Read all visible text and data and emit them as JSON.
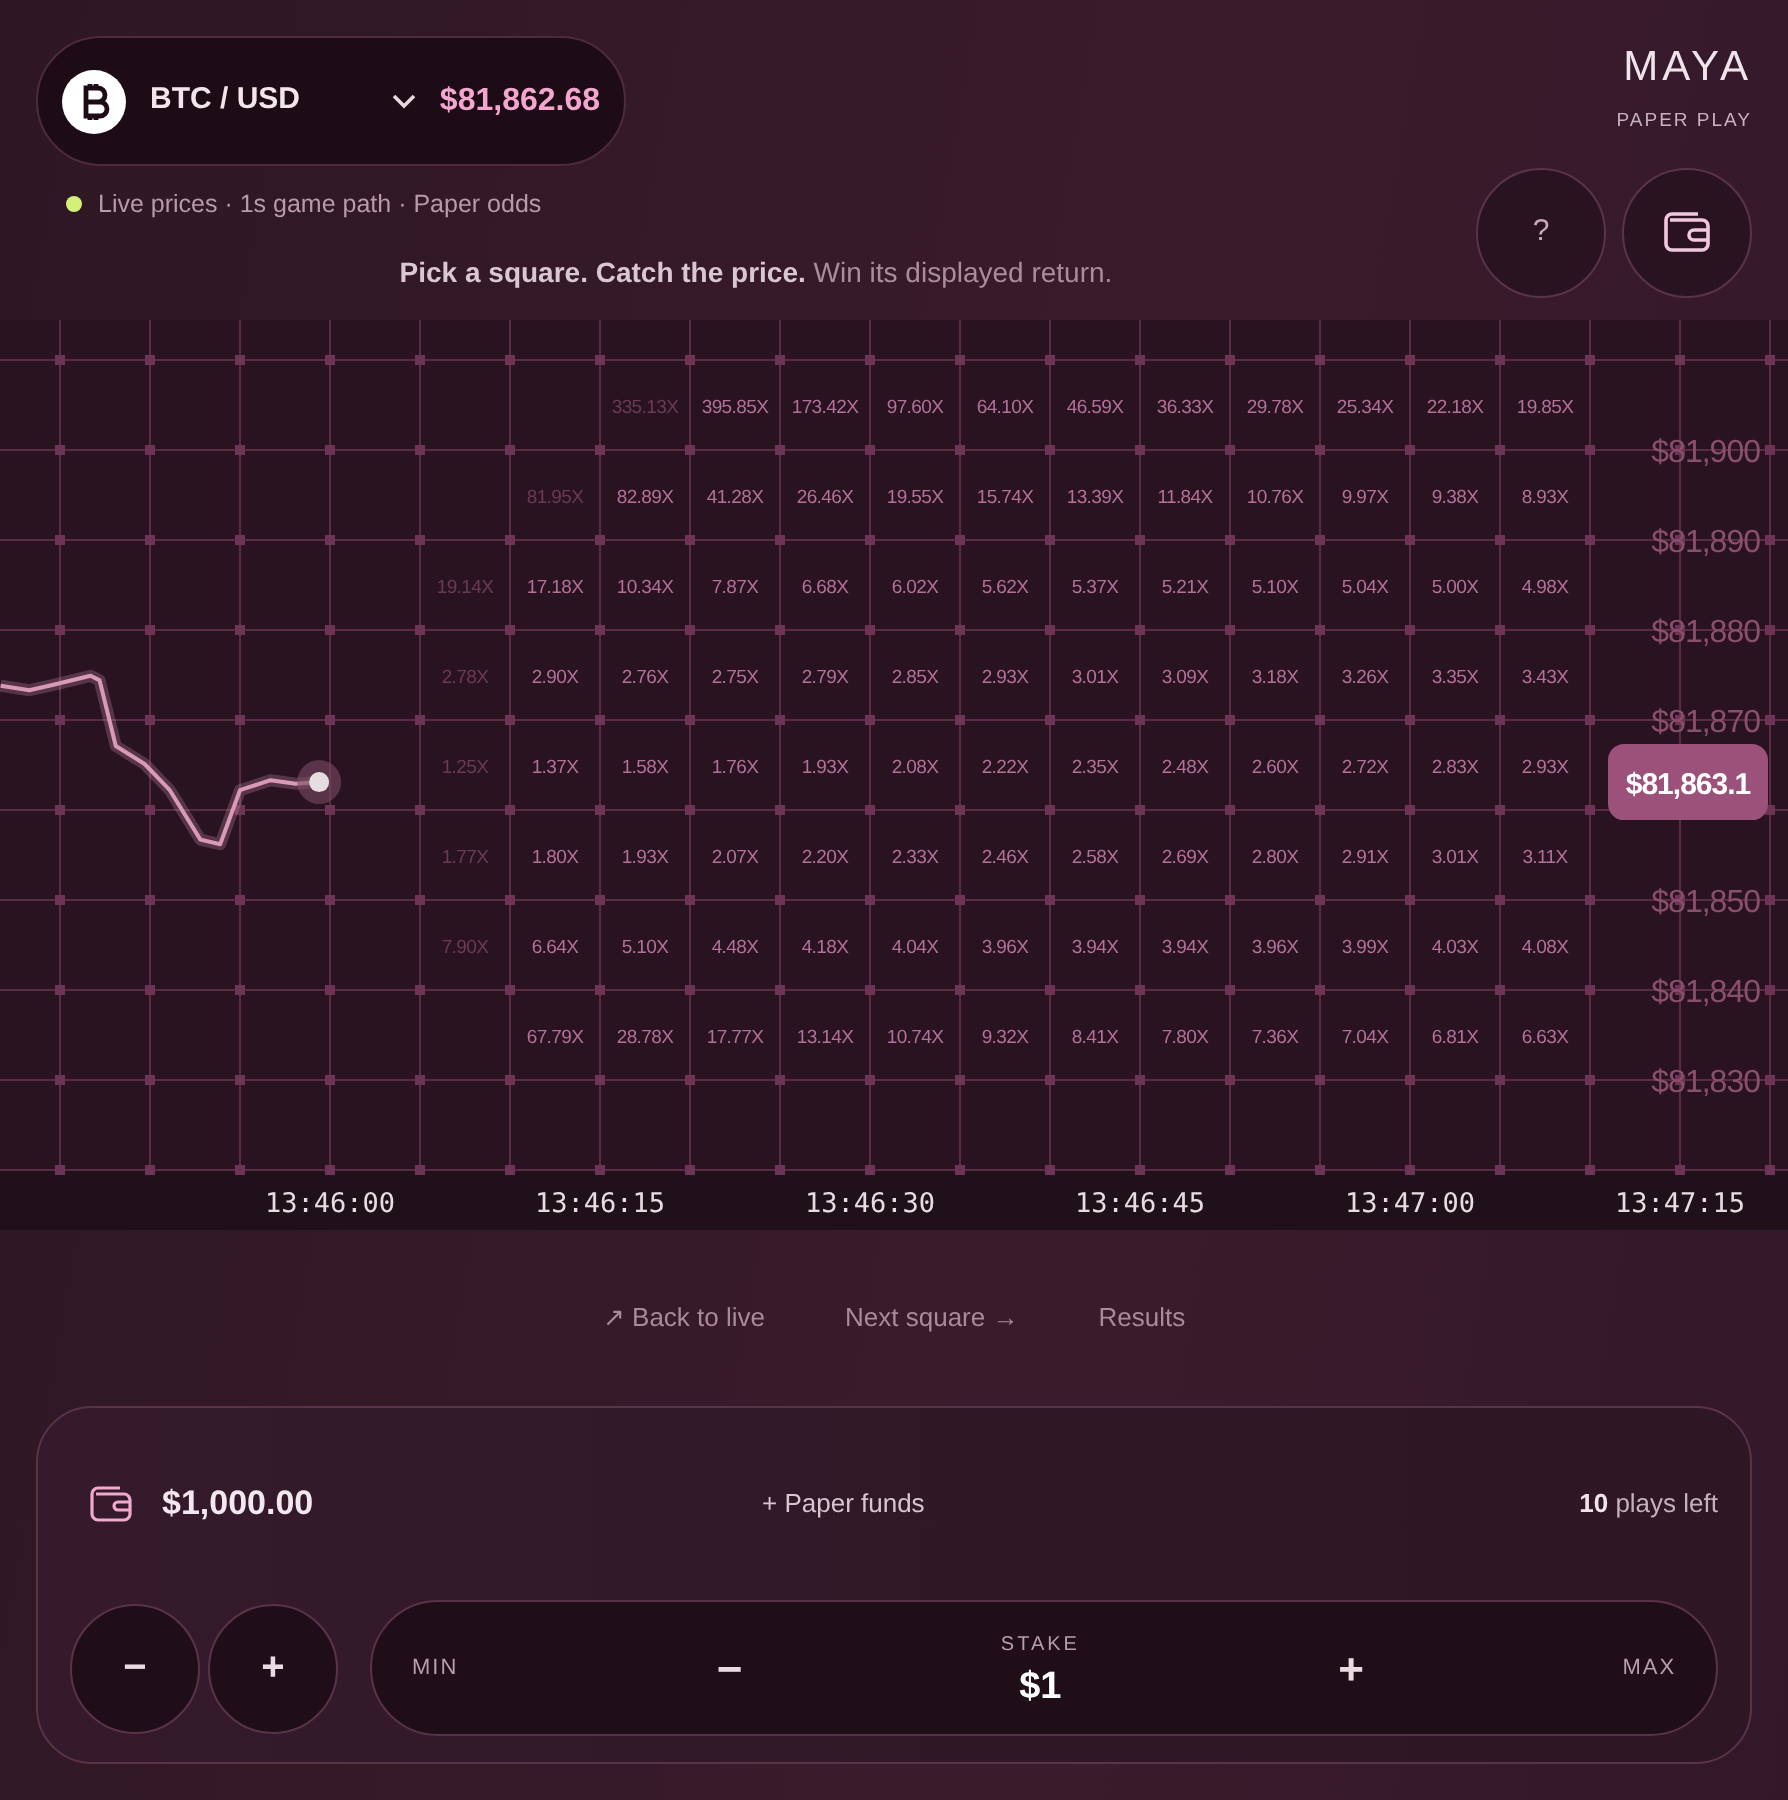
{
  "pair": {
    "label": "BTC / USD",
    "price": "$81,862.68"
  },
  "status": {
    "text": "Live prices · 1s game path · Paper odds",
    "live": true
  },
  "tagline": "**Pick a square. Catch the price.** Win its displayed return.",
  "brand": {
    "name": "MAYA",
    "subtitle": "PAPER PLAY"
  },
  "header_buttons": [
    {
      "kind": "help",
      "label": "?"
    },
    {
      "kind": "wallet"
    }
  ],
  "chart": {
    "chart_data": {
      "type": "line",
      "grid": true,
      "series": [
        {
          "color": "#d99ab8",
          "values": [
            81873.8,
            81873.3,
            81873.8,
            81874.9,
            81874.4,
            81867.1,
            81865.1,
            81862.2,
            81856.7,
            81856.2,
            81862.2,
            81863.3,
            81862.9,
            81863.1
          ]
        }
      ],
      "x": [
        49541.7,
        49543.3,
        49544.4,
        49546.7,
        49547.2,
        49548.1,
        49549.7,
        49551.1,
        49552.8,
        49553.9,
        49555,
        49556.7,
        49558.1,
        49559.4
      ],
      "xlim": [
        49541.67,
        49641
      ],
      "ylim": [
        81813.33,
        81914.44
      ],
      "xticks": [
        {
          "value": 49560,
          "label": "13:46:00"
        },
        {
          "value": 49575,
          "label": "13:46:15"
        },
        {
          "value": 49590,
          "label": "13:46:30"
        },
        {
          "value": 49605,
          "label": "13:46:45"
        },
        {
          "value": 49620,
          "label": "13:47:00"
        },
        {
          "value": 49635,
          "label": "13:47:15"
        }
      ],
      "yticks": [
        {
          "value": 81900,
          "label": "$81,900"
        },
        {
          "value": 81890,
          "label": "$81,890"
        },
        {
          "value": 81880,
          "label": "$81,880"
        },
        {
          "value": 81870,
          "label": "$81,870"
        },
        {
          "value": 81850,
          "label": "$81,850"
        },
        {
          "value": 81840,
          "label": "$81,840"
        },
        {
          "value": 81830,
          "label": "$81,830"
        }
      ]
    },
    "current_price": "$81,863.1",
    "grid": [
      [
        {
          "text": "335.13X",
          "faded": true
        },
        {
          "text": "395.85X",
          "faded": false
        },
        {
          "text": "173.42X",
          "faded": false
        },
        {
          "text": "97.60X",
          "faded": false
        },
        {
          "text": "64.10X",
          "faded": false
        },
        {
          "text": "46.59X",
          "faded": false
        },
        {
          "text": "36.33X",
          "faded": false
        },
        {
          "text": "29.78X",
          "faded": false
        },
        {
          "text": "25.34X",
          "faded": false
        },
        {
          "text": "22.18X",
          "faded": false
        },
        {
          "text": "19.85X",
          "faded": false
        }
      ],
      [
        {
          "text": "81.95X",
          "faded": true
        },
        {
          "text": "82.89X",
          "faded": false
        },
        {
          "text": "41.28X",
          "faded": false
        },
        {
          "text": "26.46X",
          "faded": false
        },
        {
          "text": "19.55X",
          "faded": false
        },
        {
          "text": "15.74X",
          "faded": false
        },
        {
          "text": "13.39X",
          "faded": false
        },
        {
          "text": "11.84X",
          "faded": false
        },
        {
          "text": "10.76X",
          "faded": false
        },
        {
          "text": "9.97X",
          "faded": false
        },
        {
          "text": "9.38X",
          "faded": false
        },
        {
          "text": "8.93X",
          "faded": false
        }
      ],
      [
        {
          "text": "19.14X",
          "faded": true
        },
        {
          "text": "17.18X",
          "faded": false
        },
        {
          "text": "10.34X",
          "faded": false
        },
        {
          "text": "7.87X",
          "faded": false
        },
        {
          "text": "6.68X",
          "faded": false
        },
        {
          "text": "6.02X",
          "faded": false
        },
        {
          "text": "5.62X",
          "faded": false
        },
        {
          "text": "5.37X",
          "faded": false
        },
        {
          "text": "5.21X",
          "faded": false
        },
        {
          "text": "5.10X",
          "faded": false
        },
        {
          "text": "5.04X",
          "faded": false
        },
        {
          "text": "5.00X",
          "faded": false
        },
        {
          "text": "4.98X",
          "faded": false
        }
      ],
      [
        {
          "text": "2.78X",
          "faded": true
        },
        {
          "text": "2.90X",
          "faded": false
        },
        {
          "text": "2.76X",
          "faded": false
        },
        {
          "text": "2.75X",
          "faded": false
        },
        {
          "text": "2.79X",
          "faded": false
        },
        {
          "text": "2.85X",
          "faded": false
        },
        {
          "text": "2.93X",
          "faded": false
        },
        {
          "text": "3.01X",
          "faded": false
        },
        {
          "text": "3.09X",
          "faded": false
        },
        {
          "text": "3.18X",
          "faded": false
        },
        {
          "text": "3.26X",
          "faded": false
        },
        {
          "text": "3.35X",
          "faded": false
        },
        {
          "text": "3.43X",
          "faded": false
        }
      ],
      [
        {
          "text": "1.25X",
          "faded": true
        },
        {
          "text": "1.37X",
          "faded": false
        },
        {
          "text": "1.58X",
          "faded": false
        },
        {
          "text": "1.76X",
          "faded": false
        },
        {
          "text": "1.93X",
          "faded": false
        },
        {
          "text": "2.08X",
          "faded": false
        },
        {
          "text": "2.22X",
          "faded": false
        },
        {
          "text": "2.35X",
          "faded": false
        },
        {
          "text": "2.48X",
          "faded": false
        },
        {
          "text": "2.60X",
          "faded": false
        },
        {
          "text": "2.72X",
          "faded": false
        },
        {
          "text": "2.83X",
          "faded": false
        },
        {
          "text": "2.93X",
          "faded": false
        }
      ],
      [
        {
          "text": "1.77X",
          "faded": true
        },
        {
          "text": "1.80X",
          "faded": false
        },
        {
          "text": "1.93X",
          "faded": false
        },
        {
          "text": "2.07X",
          "faded": false
        },
        {
          "text": "2.20X",
          "faded": false
        },
        {
          "text": "2.33X",
          "faded": false
        },
        {
          "text": "2.46X",
          "faded": false
        },
        {
          "text": "2.58X",
          "faded": false
        },
        {
          "text": "2.69X",
          "faded": false
        },
        {
          "text": "2.80X",
          "faded": false
        },
        {
          "text": "2.91X",
          "faded": false
        },
        {
          "text": "3.01X",
          "faded": false
        },
        {
          "text": "3.11X",
          "faded": false
        }
      ],
      [
        {
          "text": "7.90X",
          "faded": true
        },
        {
          "text": "6.64X",
          "faded": false
        },
        {
          "text": "5.10X",
          "faded": false
        },
        {
          "text": "4.48X",
          "faded": false
        },
        {
          "text": "4.18X",
          "faded": false
        },
        {
          "text": "4.04X",
          "faded": false
        },
        {
          "text": "3.96X",
          "faded": false
        },
        {
          "text": "3.94X",
          "faded": false
        },
        {
          "text": "3.94X",
          "faded": false
        },
        {
          "text": "3.96X",
          "faded": false
        },
        {
          "text": "3.99X",
          "faded": false
        },
        {
          "text": "4.03X",
          "faded": false
        },
        {
          "text": "4.08X",
          "faded": false
        }
      ],
      [
        {
          "text": "67.79X",
          "faded": false
        },
        {
          "text": "28.78X",
          "faded": false
        },
        {
          "text": "17.77X",
          "faded": false
        },
        {
          "text": "13.14X",
          "faded": false
        },
        {
          "text": "10.74X",
          "faded": false
        },
        {
          "text": "9.32X",
          "faded": false
        },
        {
          "text": "8.41X",
          "faded": false
        },
        {
          "text": "7.80X",
          "faded": false
        },
        {
          "text": "7.36X",
          "faded": false
        },
        {
          "text": "7.04X",
          "faded": false
        },
        {
          "text": "6.81X",
          "faded": false
        },
        {
          "text": "6.63X",
          "faded": false
        }
      ]
    ]
  },
  "links": [
    "↗ Back to live",
    "Next square →",
    "Results"
  ],
  "wallet": {
    "balance": "$1,000.00",
    "add_funds": "+ Paper funds",
    "plays_left": "**10** plays left"
  },
  "quick_buttons": [
    "−",
    "+"
  ],
  "stake": {
    "min": "MIN",
    "decrease": "−",
    "label": "STAKE",
    "value": "$1",
    "increase": "+",
    "max": "MAX"
  }
}
